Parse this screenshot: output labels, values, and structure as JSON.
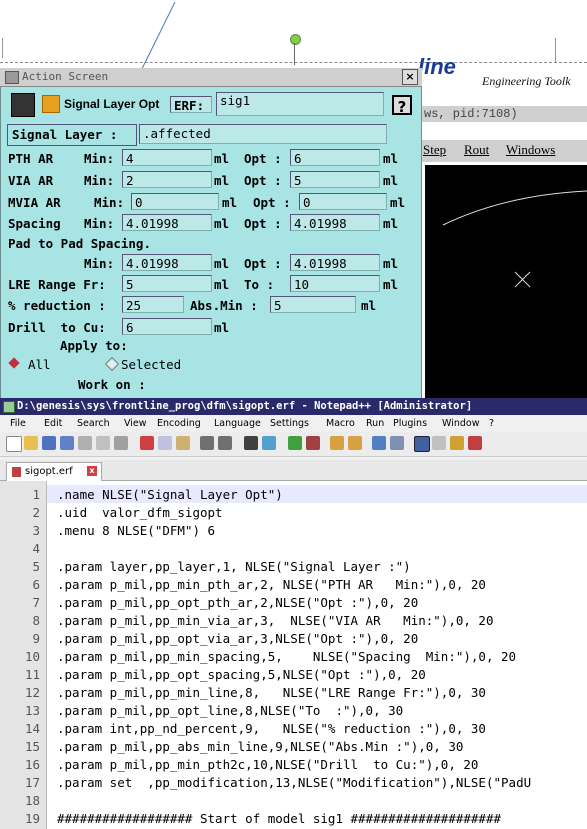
{
  "genesis": {
    "logo": "line",
    "subtitle": "Engineering Toolk",
    "title_fragment": "ws, pid:7108)",
    "menu": [
      "Step",
      "Rout",
      "Windows"
    ]
  },
  "action_screen": {
    "title": "Action Screen",
    "close": "×",
    "tool_name": "Signal Layer Opt",
    "erf_label": "ERF:",
    "erf_value": "sig1",
    "help": "?",
    "signal_layer_label": "Signal Layer :",
    "signal_layer_value": ".affected",
    "pth": {
      "label": "PTH AR",
      "min_label": "Min:",
      "min": "4",
      "unit1": "ml",
      "opt_label": "Opt :",
      "opt": "6",
      "unit2": "ml"
    },
    "via": {
      "label": "VIA AR",
      "min_label": "Min:",
      "min": "2",
      "unit1": "ml",
      "opt_label": "Opt :",
      "opt": "5",
      "unit2": "ml"
    },
    "mvia": {
      "label": "MVIA AR",
      "min_label": "Min:",
      "min": "0",
      "unit1": "ml",
      "opt_label": "Opt :",
      "opt": "0",
      "unit2": "ml"
    },
    "spacing": {
      "label": "Spacing",
      "min_label": "Min:",
      "min": "4.01998",
      "unit1": "ml",
      "opt_label": "Opt :",
      "opt": "4.01998",
      "unit2": "ml"
    },
    "pad_heading": "Pad to Pad Spacing.",
    "pad": {
      "min_label": "Min:",
      "min": "4.01998",
      "unit1": "ml",
      "opt_label": "Opt :",
      "opt": "4.01998",
      "unit2": "ml"
    },
    "lre": {
      "label": "LRE Range Fr:",
      "from": "5",
      "unit1": "ml",
      "to_label": "To :",
      "to": "10",
      "unit2": "ml"
    },
    "reduction": {
      "label": "% reduction :",
      "value": "25",
      "abs_label": "Abs.Min :",
      "abs": "5",
      "unit": "ml"
    },
    "drill": {
      "label": "Drill  to Cu:",
      "value": "6",
      "unit": "ml"
    },
    "apply_to": "Apply to:",
    "opt_all": "All",
    "opt_selected": "Selected",
    "work_on": "Work on :"
  },
  "notepad": {
    "title": "D:\\genesis\\sys\\frontline_prog\\dfm\\sigopt.erf - Notepad++ [Administrator]",
    "menu": [
      "File",
      "Edit",
      "Search",
      "View",
      "Encoding",
      "Language",
      "Settings",
      "Macro",
      "Run",
      "Plugins",
      "Window",
      "?"
    ],
    "tab": "sigopt.erf",
    "lines": [
      {
        "n": "1",
        "text": ".name NLSE(\"Signal Layer Opt\")"
      },
      {
        "n": "2",
        "text": ".uid  valor_dfm_sigopt"
      },
      {
        "n": "3",
        "text": ".menu 8 NLSE(\"DFM\") 6"
      },
      {
        "n": "4",
        "text": ""
      },
      {
        "n": "5",
        "text": ".param layer,pp_layer,1, NLSE(\"Signal Layer :\")"
      },
      {
        "n": "6",
        "text": ".param p_mil,pp_min_pth_ar,2, NLSE(\"PTH AR   Min:\"),0, 20"
      },
      {
        "n": "7",
        "text": ".param p_mil,pp_opt_pth_ar,2,NLSE(\"Opt :\"),0, 20"
      },
      {
        "n": "8",
        "text": ".param p_mil,pp_min_via_ar,3,  NLSE(\"VIA AR   Min:\"),0, 20"
      },
      {
        "n": "9",
        "text": ".param p_mil,pp_opt_via_ar,3,NLSE(\"Opt :\"),0, 20"
      },
      {
        "n": "10",
        "text": ".param p_mil,pp_min_spacing,5,    NLSE(\"Spacing  Min:\"),0, 20"
      },
      {
        "n": "11",
        "text": ".param p_mil,pp_opt_spacing,5,NLSE(\"Opt :\"),0, 20"
      },
      {
        "n": "12",
        "text": ".param p_mil,pp_min_line,8,   NLSE(\"LRE Range Fr:\"),0, 30"
      },
      {
        "n": "13",
        "text": ".param p_mil,pp_opt_line,8,NLSE(\"To  :\"),0, 30"
      },
      {
        "n": "14",
        "text": ".param int,pp_nd_percent,9,   NLSE(\"% reduction :\"),0, 30"
      },
      {
        "n": "15",
        "text": ".param p_mil,pp_abs_min_line,9,NLSE(\"Abs.Min :\"),0, 30"
      },
      {
        "n": "16",
        "text": ".param p_mil,pp_min_pth2c,10,NLSE(\"Drill  to Cu:\"),0, 20"
      },
      {
        "n": "17",
        "text": ".param set  ,pp_modification,13,NLSE(\"Modification\"),NLSE(\"PadU"
      },
      {
        "n": "18",
        "text": ""
      },
      {
        "n": "19",
        "text": "################## Start of model sig1 ####################"
      }
    ]
  }
}
